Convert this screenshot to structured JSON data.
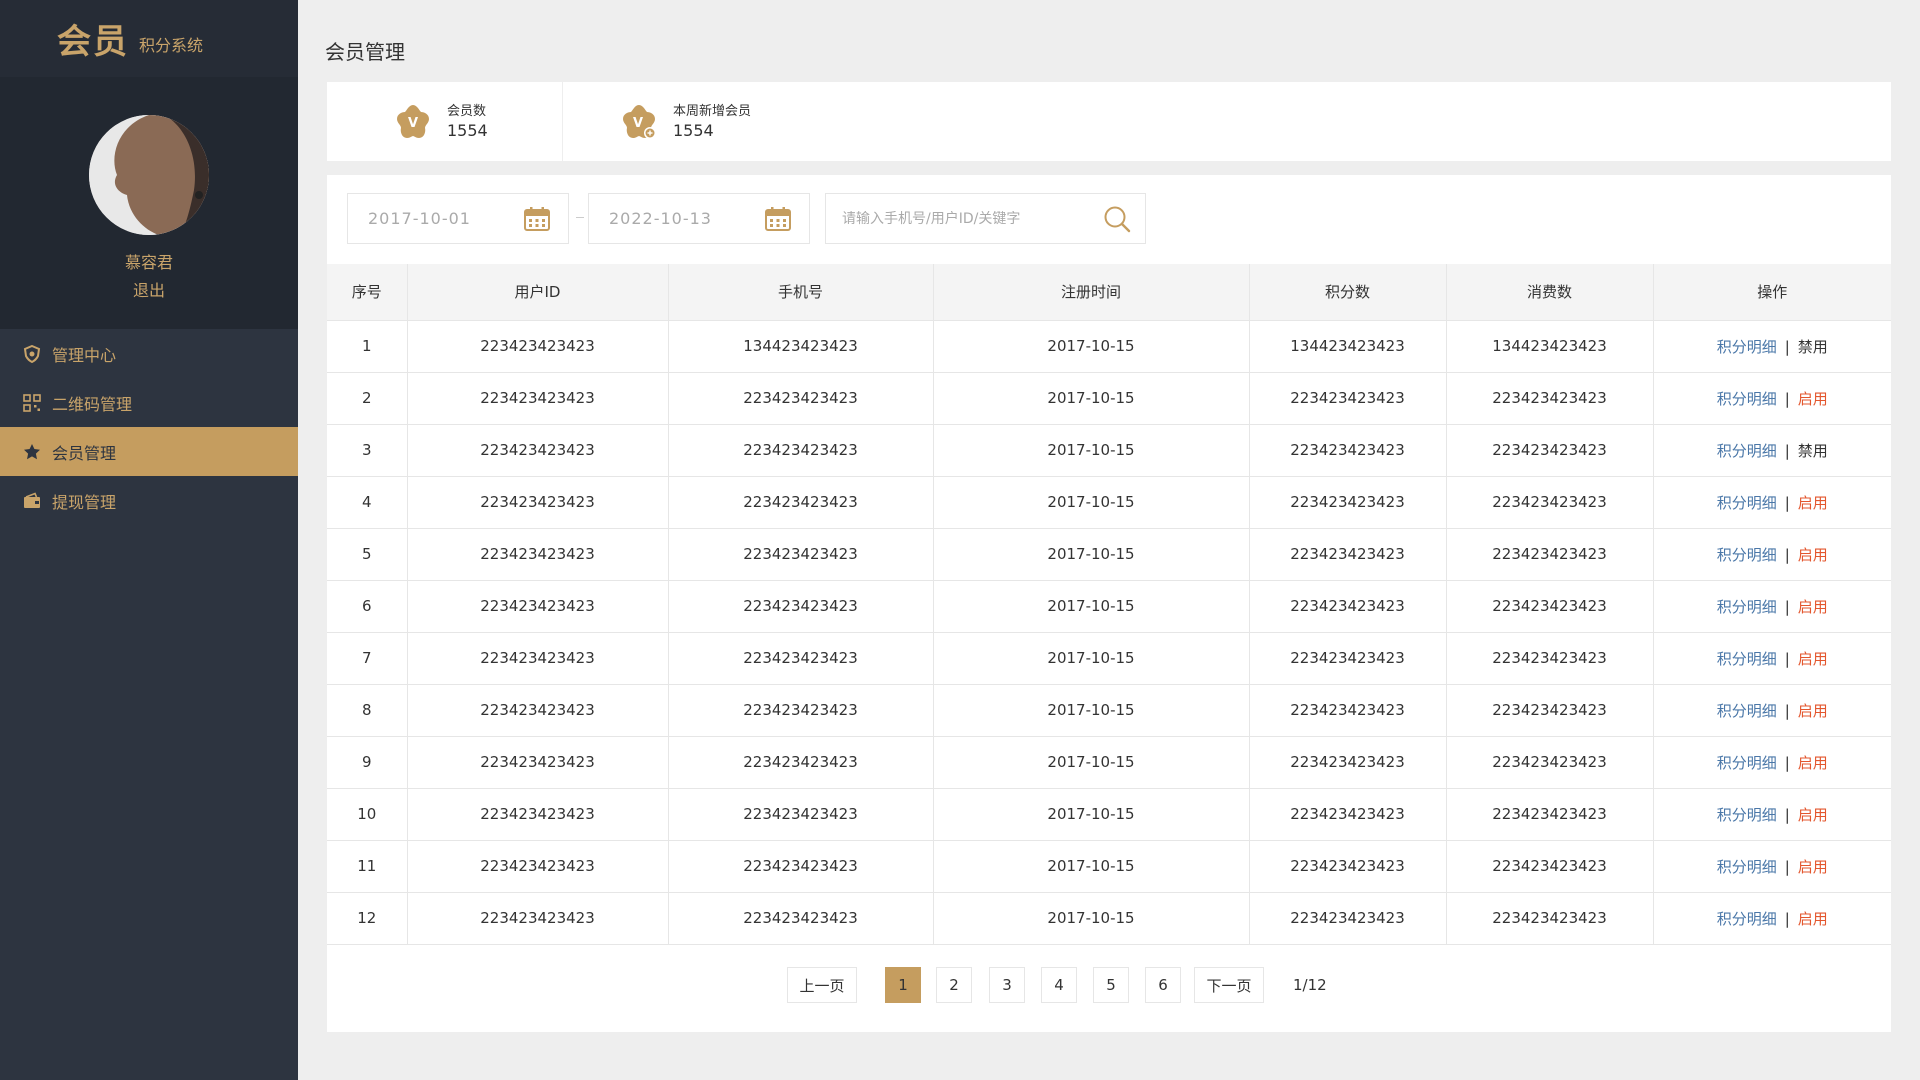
{
  "brand": {
    "main": "会员",
    "sub": "积分系统"
  },
  "user": {
    "name": "慕容君",
    "logout": "退出"
  },
  "nav": [
    {
      "label": "管理中心",
      "icon": "shield-icon",
      "active": false
    },
    {
      "label": "二维码管理",
      "icon": "qrcode-icon",
      "active": false
    },
    {
      "label": "会员管理",
      "icon": "star-badge-icon",
      "active": true
    },
    {
      "label": "提现管理",
      "icon": "wallet-icon",
      "active": false
    }
  ],
  "page_title": "会员管理",
  "stats": [
    {
      "label": "会员数",
      "value": "1554",
      "icon": "member-badge-icon"
    },
    {
      "label": "本周新增会员",
      "value": "1554",
      "icon": "new-member-badge-icon"
    }
  ],
  "filters": {
    "start_date": "2017-10-01",
    "end_date": "2022-10-13",
    "search_placeholder": "请输入手机号/用户ID/关键字"
  },
  "table": {
    "headers": [
      "序号",
      "用户ID",
      "手机号",
      "注册时间",
      "积分数",
      "消费数",
      "操作"
    ],
    "rows": [
      {
        "no": "1",
        "uid": "223423423423",
        "phone": "134423423423",
        "date": "2017-10-15",
        "points": "134423423423",
        "spent": "134423423423",
        "detail": "积分明细",
        "action": "禁用",
        "action_type": "disable"
      },
      {
        "no": "2",
        "uid": "223423423423",
        "phone": "223423423423",
        "date": "2017-10-15",
        "points": "223423423423",
        "spent": "223423423423",
        "detail": "积分明细",
        "action": "启用",
        "action_type": "enable"
      },
      {
        "no": "3",
        "uid": "223423423423",
        "phone": "223423423423",
        "date": "2017-10-15",
        "points": "223423423423",
        "spent": "223423423423",
        "detail": "积分明细",
        "action": "禁用",
        "action_type": "disable"
      },
      {
        "no": "4",
        "uid": "223423423423",
        "phone": "223423423423",
        "date": "2017-10-15",
        "points": "223423423423",
        "spent": "223423423423",
        "detail": "积分明细",
        "action": "启用",
        "action_type": "enable"
      },
      {
        "no": "5",
        "uid": "223423423423",
        "phone": "223423423423",
        "date": "2017-10-15",
        "points": "223423423423",
        "spent": "223423423423",
        "detail": "积分明细",
        "action": "启用",
        "action_type": "enable"
      },
      {
        "no": "6",
        "uid": "223423423423",
        "phone": "223423423423",
        "date": "2017-10-15",
        "points": "223423423423",
        "spent": "223423423423",
        "detail": "积分明细",
        "action": "启用",
        "action_type": "enable"
      },
      {
        "no": "7",
        "uid": "223423423423",
        "phone": "223423423423",
        "date": "2017-10-15",
        "points": "223423423423",
        "spent": "223423423423",
        "detail": "积分明细",
        "action": "启用",
        "action_type": "enable"
      },
      {
        "no": "8",
        "uid": "223423423423",
        "phone": "223423423423",
        "date": "2017-10-15",
        "points": "223423423423",
        "spent": "223423423423",
        "detail": "积分明细",
        "action": "启用",
        "action_type": "enable"
      },
      {
        "no": "9",
        "uid": "223423423423",
        "phone": "223423423423",
        "date": "2017-10-15",
        "points": "223423423423",
        "spent": "223423423423",
        "detail": "积分明细",
        "action": "启用",
        "action_type": "enable"
      },
      {
        "no": "10",
        "uid": "223423423423",
        "phone": "223423423423",
        "date": "2017-10-15",
        "points": "223423423423",
        "spent": "223423423423",
        "detail": "积分明细",
        "action": "启用",
        "action_type": "enable"
      },
      {
        "no": "11",
        "uid": "223423423423",
        "phone": "223423423423",
        "date": "2017-10-15",
        "points": "223423423423",
        "spent": "223423423423",
        "detail": "积分明细",
        "action": "启用",
        "action_type": "enable"
      },
      {
        "no": "12",
        "uid": "223423423423",
        "phone": "223423423423",
        "date": "2017-10-15",
        "points": "223423423423",
        "spent": "223423423423",
        "detail": "积分明细",
        "action": "启用",
        "action_type": "enable"
      }
    ],
    "separator": "|"
  },
  "pagination": {
    "prev": "上一页",
    "pages": [
      "1",
      "2",
      "3",
      "4",
      "5",
      "6"
    ],
    "current": "1",
    "next": "下一页",
    "total": "1/12"
  },
  "colors": {
    "accent": "#c59d5f",
    "sidebar": "#2d3440",
    "link": "#4a77a8",
    "enable": "#e3562d"
  }
}
